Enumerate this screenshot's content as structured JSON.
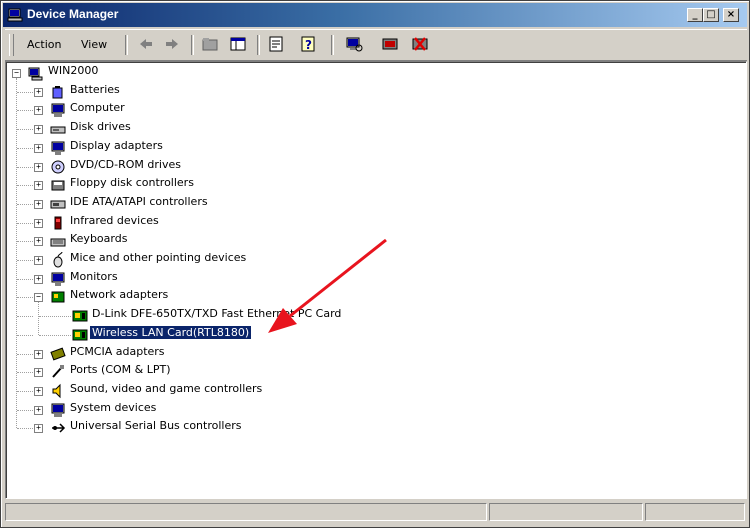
{
  "window": {
    "title": "Device Manager"
  },
  "caption_buttons": {
    "minimize": "_",
    "maximize": "□",
    "close": "×"
  },
  "menu": {
    "action": "Action",
    "view": "View"
  },
  "tree": {
    "root": "WIN2000",
    "categories": [
      {
        "label": "Batteries",
        "icon": "battery-icon"
      },
      {
        "label": "Computer",
        "icon": "computer-icon"
      },
      {
        "label": "Disk drives",
        "icon": "disk-drive-icon"
      },
      {
        "label": "Display adapters",
        "icon": "display-adapter-icon"
      },
      {
        "label": "DVD/CD-ROM drives",
        "icon": "cdrom-icon"
      },
      {
        "label": "Floppy disk controllers",
        "icon": "floppy-controller-icon"
      },
      {
        "label": "IDE ATA/ATAPI controllers",
        "icon": "ide-controller-icon"
      },
      {
        "label": "Infrared devices",
        "icon": "infrared-icon"
      },
      {
        "label": "Keyboards",
        "icon": "keyboard-icon"
      },
      {
        "label": "Mice and other pointing devices",
        "icon": "mouse-icon"
      },
      {
        "label": "Monitors",
        "icon": "monitor-icon"
      },
      {
        "label": "Network adapters",
        "icon": "network-adapter-icon"
      }
    ],
    "network_children": [
      "D-Link DFE-650TX/TXD Fast Ethernet PC Card",
      "Wireless LAN Card(RTL8180)"
    ],
    "categories_after": [
      {
        "label": "PCMCIA adapters",
        "icon": "pcmcia-icon"
      },
      {
        "label": "Ports (COM & LPT)",
        "icon": "port-icon"
      },
      {
        "label": "Sound, video and game controllers",
        "icon": "sound-icon"
      },
      {
        "label": "System devices",
        "icon": "system-devices-icon"
      },
      {
        "label": "Universal Serial Bus controllers",
        "icon": "usb-icon"
      }
    ],
    "selected": "Wireless LAN Card(RTL8180)"
  },
  "colors": {
    "selection": "#0a246a",
    "annotation_arrow": "#e8141e",
    "titlebar_start": "#0a246a",
    "titlebar_end": "#a6caf0"
  }
}
